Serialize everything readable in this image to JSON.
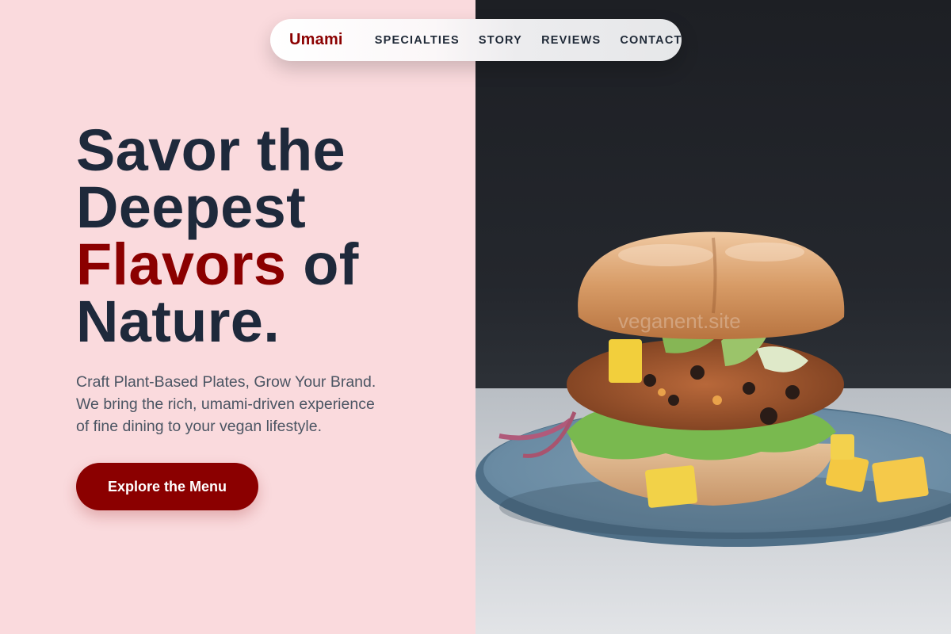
{
  "nav": {
    "brand": "Umami",
    "links": [
      "SPECIALTIES",
      "STORY",
      "REVIEWS",
      "CONTACT"
    ]
  },
  "hero": {
    "title_line1": "Savor the",
    "title_line2": "Deepest",
    "title_accent": "Flavors",
    "title_line3_rest": " of",
    "title_line4": "Nature.",
    "subtitle_line1": "Craft Plant-Based Plates, Grow Your Brand.",
    "subtitle_line2": "We bring the rich, umami-driven experience",
    "subtitle_line3": "of fine dining to your vegan lifestyle.",
    "cta_label": "Explore the Menu"
  },
  "image": {
    "subject": "burger-photo",
    "watermark": "veganent.site"
  },
  "colors": {
    "accent": "#8b0000",
    "heading": "#1e293b",
    "body_text": "#4b5563",
    "left_background": "#fadadd"
  }
}
